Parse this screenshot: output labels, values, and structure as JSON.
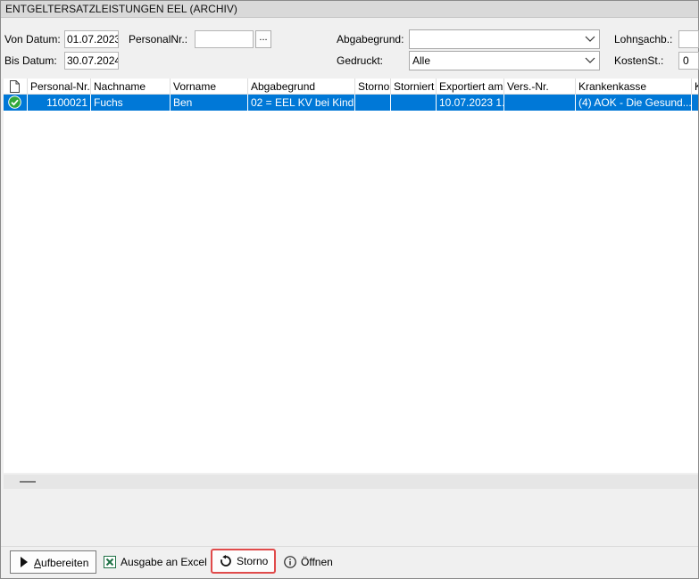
{
  "window": {
    "title": "ENTGELTERSATZLEISTUNGEN EEL (ARCHIV)"
  },
  "filters": {
    "von_datum_label": "Von Datum:",
    "von_datum_value": "01.07.2023",
    "bis_datum_label": "Bis Datum:",
    "bis_datum_value": "30.07.2024",
    "personalnr_label": "PersonalNr.:",
    "personalnr_value": "",
    "lookup_button": "...",
    "abgabegrund_label": "Abgabegrund:",
    "abgabegrund_value": "",
    "gedruckt_label": "Gedruckt:",
    "gedruckt_value": "Alle",
    "lohnsachb_label_pre": "Lohn",
    "lohnsachb_label_u": "s",
    "lohnsachb_label_post": "achb.:",
    "lohnsachb_value": "",
    "kostenst_label": "KostenSt.:",
    "kostenst_value": "0"
  },
  "grid": {
    "columns": [
      "",
      "Personal-Nr.",
      "Nachname",
      "Vorname",
      "Abgabegrund",
      "Storno",
      "Storniert",
      "Exportiert am",
      "Vers.-Nr.",
      "Krankenkasse",
      "K"
    ],
    "rows": [
      {
        "personal_nr": "1100021",
        "nachname": "Fuchs",
        "vorname": "Ben",
        "abgabegrund": "02 = EEL KV bei Kind...",
        "storno": "",
        "storniert": "",
        "exportiert_am": "10.07.2023 1...",
        "vers_nr": "",
        "krankenkasse": "(4) AOK - Die Gesund...",
        "k": ""
      }
    ]
  },
  "toolbar": {
    "aufbereiten_u": "A",
    "aufbereiten_rest": "ufbereiten",
    "excel": "Ausgabe an Excel",
    "storno": "Storno",
    "oeffnen": "Öffnen"
  },
  "colors": {
    "selection": "#0078d7",
    "highlight_border": "#e04b4b",
    "excel_green": "#1e7145"
  }
}
